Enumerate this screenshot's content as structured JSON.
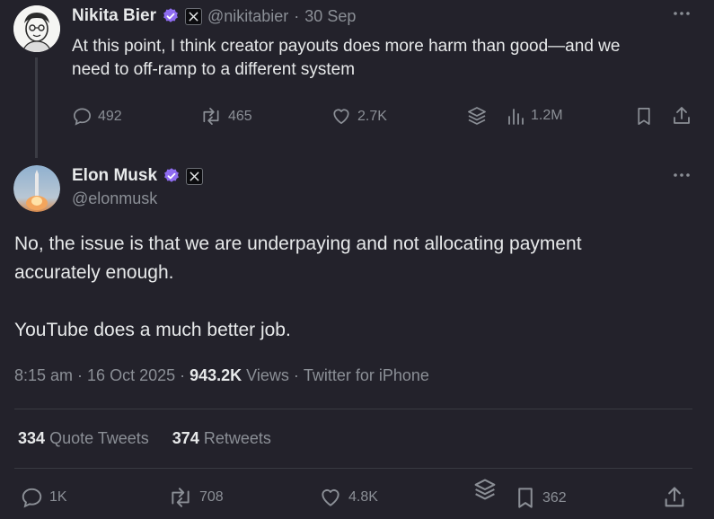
{
  "parent_tweet": {
    "author_name": "Nikita Bier",
    "handle": "@nikitabier",
    "separator": "·",
    "date": "30 Sep",
    "text_line1": "At this point, I think creator payouts does more harm than good—and we",
    "text_line2": "need to off-ramp to a different system",
    "replies": "492",
    "retweets": "465",
    "likes": "2.7K",
    "views": "1.2M"
  },
  "main_tweet": {
    "author_name": "Elon Musk",
    "handle": "@elonmusk",
    "text_line1": "No, the issue is that we are underpaying and not allocating payment",
    "text_line2": "accurately enough.",
    "text_line3": "YouTube does a much better job.",
    "time": "8:15 am",
    "dot": "·",
    "date": "16 Oct 2025",
    "views_count": "943.2K",
    "views_label": "Views",
    "source": "Twitter for iPhone",
    "quote_count": "334",
    "quote_label": "Quote Tweets",
    "retweet_count": "374",
    "retweet_label": "Retweets",
    "replies": "1K",
    "retweets": "708",
    "likes": "4.8K",
    "bookmarks": "362"
  },
  "colors": {
    "background": "#23222b",
    "text": "#e7e9ea",
    "muted": "#8b8f96",
    "verified": "#8e6cf0",
    "divider": "#393a42"
  },
  "icons": [
    "verified-badge-icon",
    "x-affiliate-icon",
    "more-icon",
    "reply-icon",
    "retweet-icon",
    "like-icon",
    "grok-icon",
    "views-icon",
    "bookmark-icon",
    "share-icon"
  ]
}
